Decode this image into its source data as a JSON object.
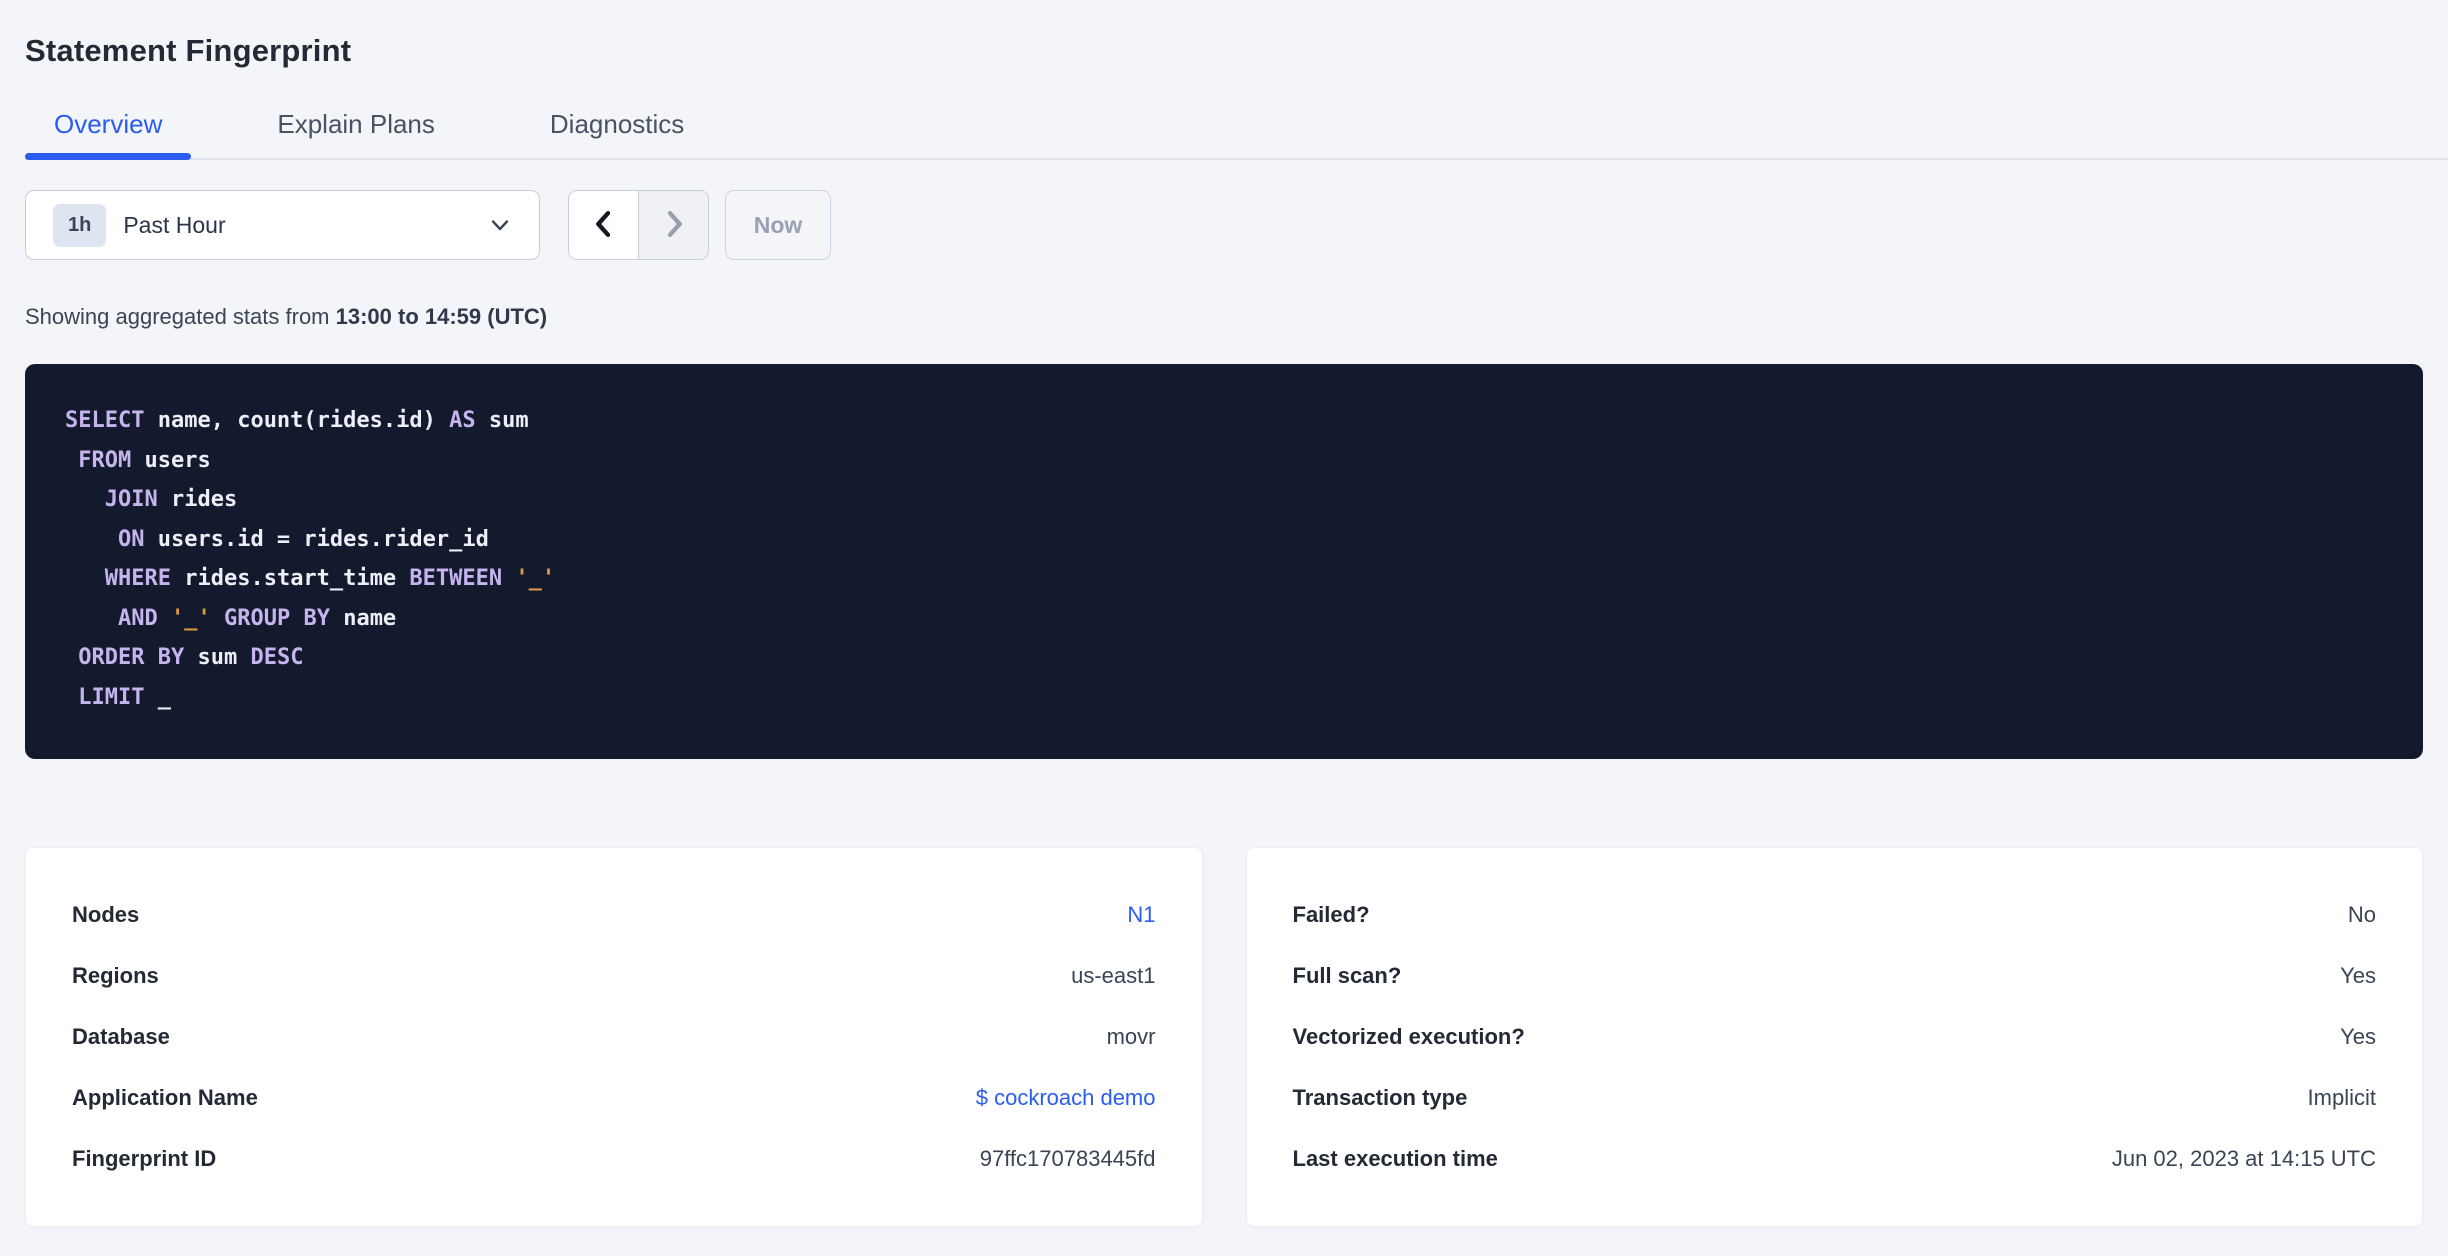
{
  "page": {
    "title": "Statement Fingerprint"
  },
  "tabs": [
    {
      "label": "Overview",
      "active": true
    },
    {
      "label": "Explain Plans",
      "active": false
    },
    {
      "label": "Diagnostics",
      "active": false
    }
  ],
  "time_picker": {
    "badge": "1h",
    "label": "Past Hour"
  },
  "nav": {
    "now_label": "Now"
  },
  "stats_line": {
    "prefix": "Showing aggregated stats from ",
    "range": "13:00 to 14:59 (UTC)"
  },
  "sql": {
    "lines": [
      [
        {
          "t": "SELECT",
          "c": "kw"
        },
        {
          "t": " name, count(rides.id) ",
          "c": "pl"
        },
        {
          "t": "AS",
          "c": "kw"
        },
        {
          "t": " sum",
          "c": "pl"
        }
      ],
      [
        {
          "t": " ",
          "c": "pl"
        },
        {
          "t": "FROM",
          "c": "kw"
        },
        {
          "t": " users",
          "c": "pl"
        }
      ],
      [
        {
          "t": "   ",
          "c": "pl"
        },
        {
          "t": "JOIN",
          "c": "kw"
        },
        {
          "t": " rides",
          "c": "pl"
        }
      ],
      [
        {
          "t": "    ",
          "c": "pl"
        },
        {
          "t": "ON",
          "c": "kw"
        },
        {
          "t": " users.id = rides.rider_id",
          "c": "pl"
        }
      ],
      [
        {
          "t": "   ",
          "c": "pl"
        },
        {
          "t": "WHERE",
          "c": "kw"
        },
        {
          "t": " rides.start_time ",
          "c": "pl"
        },
        {
          "t": "BETWEEN",
          "c": "kw"
        },
        {
          "t": " ",
          "c": "pl"
        },
        {
          "t": "'_'",
          "c": "str"
        }
      ],
      [
        {
          "t": "    ",
          "c": "pl"
        },
        {
          "t": "AND",
          "c": "kw"
        },
        {
          "t": " ",
          "c": "pl"
        },
        {
          "t": "'_'",
          "c": "str"
        },
        {
          "t": " ",
          "c": "pl"
        },
        {
          "t": "GROUP BY",
          "c": "kw"
        },
        {
          "t": " name",
          "c": "pl"
        }
      ],
      [
        {
          "t": " ",
          "c": "pl"
        },
        {
          "t": "ORDER BY",
          "c": "kw"
        },
        {
          "t": " sum ",
          "c": "pl"
        },
        {
          "t": "DESC",
          "c": "kw"
        }
      ],
      [
        {
          "t": " ",
          "c": "pl"
        },
        {
          "t": "LIMIT",
          "c": "kw"
        },
        {
          "t": " _",
          "c": "pl"
        }
      ]
    ]
  },
  "details_left": {
    "rows": [
      {
        "label": "Nodes",
        "value": "N1",
        "link": true
      },
      {
        "label": "Regions",
        "value": "us-east1",
        "link": false
      },
      {
        "label": "Database",
        "value": "movr",
        "link": false
      },
      {
        "label": "Application Name",
        "value": "$ cockroach demo",
        "link": true
      },
      {
        "label": "Fingerprint ID",
        "value": "97ffc170783445fd",
        "link": false
      }
    ]
  },
  "details_right": {
    "rows": [
      {
        "label": "Failed?",
        "value": "No",
        "link": false
      },
      {
        "label": "Full scan?",
        "value": "Yes",
        "link": false
      },
      {
        "label": "Vectorized execution?",
        "value": "Yes",
        "link": false
      },
      {
        "label": "Transaction type",
        "value": "Implicit",
        "link": false
      },
      {
        "label": "Last execution time",
        "value": "Jun 02, 2023 at 14:15 UTC",
        "link": false
      }
    ]
  },
  "colors": {
    "accent_blue": "#2a5cf0",
    "page_background": "#f4f5f9",
    "sql_background": "#141a2d",
    "sql_keyword": "#c6b4ee",
    "sql_string": "#dd9840",
    "sql_plain": "#eceff8",
    "text_dark": "#242a35",
    "text_mid": "#394455"
  }
}
